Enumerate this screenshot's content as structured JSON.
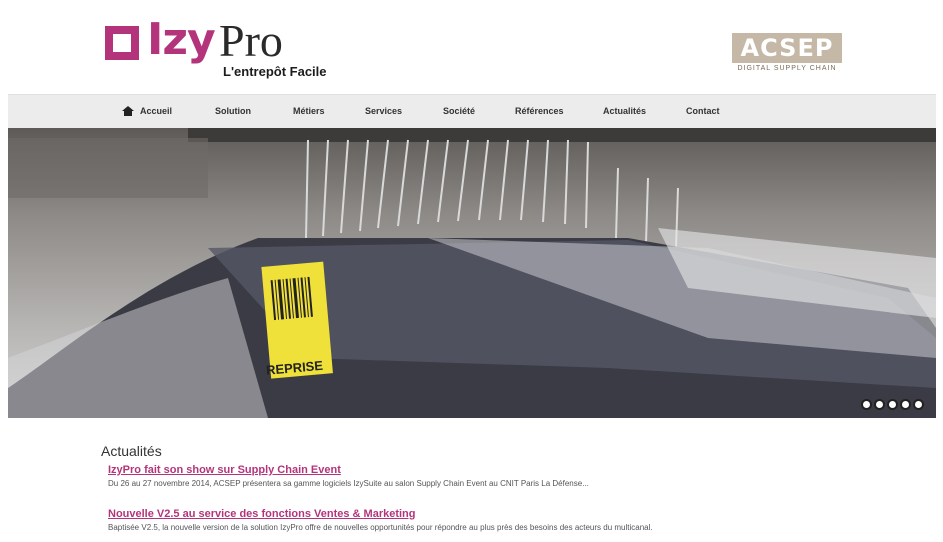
{
  "header": {
    "logo_izy": "Izy",
    "logo_pro": "Pro",
    "logo_tagline": "L'entrepôt Facile",
    "partner_logo": "ACSEP",
    "partner_subtitle": "DIGITAL SUPPLY CHAIN"
  },
  "nav": {
    "items": [
      {
        "label": "Accueil",
        "icon": "home-icon"
      },
      {
        "label": "Solution"
      },
      {
        "label": "Métiers"
      },
      {
        "label": "Services"
      },
      {
        "label": "Société"
      },
      {
        "label": "Références"
      },
      {
        "label": "Actualités"
      },
      {
        "label": "Contact"
      }
    ]
  },
  "hero": {
    "tag_text": "REPRISE",
    "slide_count": 5
  },
  "news": {
    "title": "Actualités",
    "items": [
      {
        "link": "IzyPro fait son show sur Supply Chain Event",
        "text": "Du 26 au 27 novembre 2014, ACSEP présentera sa gamme logiciels IzySuite au salon Supply Chain Event au CNIT Paris La Défense..."
      },
      {
        "link": "Nouvelle V2.5 au service des fonctions Ventes & Marketing",
        "text": "Baptisée V2.5, la nouvelle version de la solution IzyPro offre de nouvelles opportunités pour répondre au plus près des besoins des acteurs du multicanal."
      }
    ]
  },
  "colors": {
    "brand": "#b4347c",
    "partner": "#c5b8a6",
    "nav_bg": "#ececec"
  }
}
